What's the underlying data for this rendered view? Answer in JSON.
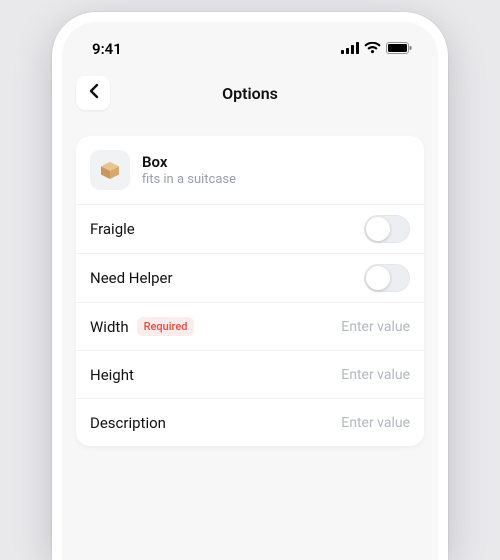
{
  "status": {
    "time": "9:41"
  },
  "nav": {
    "title": "Options"
  },
  "header": {
    "title": "Box",
    "subtitle": "fits in a suitcase"
  },
  "rows": {
    "fragile": {
      "label": "Fraigle"
    },
    "helper": {
      "label": "Need Helper"
    },
    "width": {
      "label": "Width",
      "badge": "Required",
      "placeholder": "Enter value"
    },
    "height": {
      "label": "Height",
      "placeholder": "Enter value"
    },
    "description": {
      "label": "Description",
      "placeholder": "Enter value"
    }
  }
}
